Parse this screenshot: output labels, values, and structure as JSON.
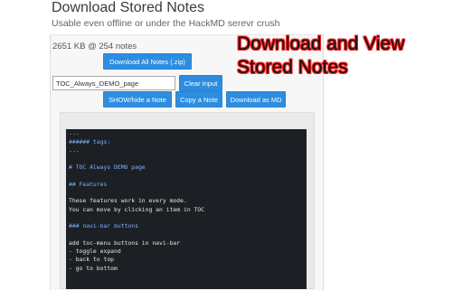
{
  "header": {
    "title": "Download Stored Notes",
    "subtitle": "Usable even offline or under the HackMD serevr crush"
  },
  "stats": {
    "text": "2651 KB @ 254 notes"
  },
  "buttons": {
    "download_all": "Download All Notes (.zip)",
    "clear_input": "Clear Input",
    "show_hide": "SHOW/hide a Note",
    "copy": "Copy a Note",
    "download_md": "Download as MD"
  },
  "note_input": {
    "value": "TOC_Always_DEMO_page"
  },
  "overlay": {
    "line1": "Download and View",
    "line2": "Stored Notes"
  },
  "note_content": [
    {
      "text": "---",
      "style": "muted"
    },
    {
      "text": "###### tags:",
      "style": "heading"
    },
    {
      "text": "---",
      "style": "muted"
    },
    {
      "text": "",
      "style": "plain"
    },
    {
      "text": "# TOC Always DEMO page",
      "style": "heading"
    },
    {
      "text": "",
      "style": "plain"
    },
    {
      "text": "## Features",
      "style": "heading"
    },
    {
      "text": "",
      "style": "plain"
    },
    {
      "text": "These features work in every mode.",
      "style": "plain"
    },
    {
      "text": "You can move by clicking an item in TOC",
      "style": "plain"
    },
    {
      "text": "",
      "style": "plain"
    },
    {
      "text": "### navi-bar buttons",
      "style": "heading"
    },
    {
      "text": "",
      "style": "plain"
    },
    {
      "text": "add toc-menu buttons in navi-bar",
      "style": "plain"
    },
    {
      "text": "- toggle expand",
      "style": "plain"
    },
    {
      "text": "- back to top",
      "style": "plain"
    },
    {
      "text": "- go to bottom",
      "style": "plain"
    }
  ],
  "colors": {
    "button": "#2d8de0",
    "editor_bg": "#1c1f24",
    "heading_text": "#7fb3ff",
    "overlay_outline": "#ff2222"
  }
}
